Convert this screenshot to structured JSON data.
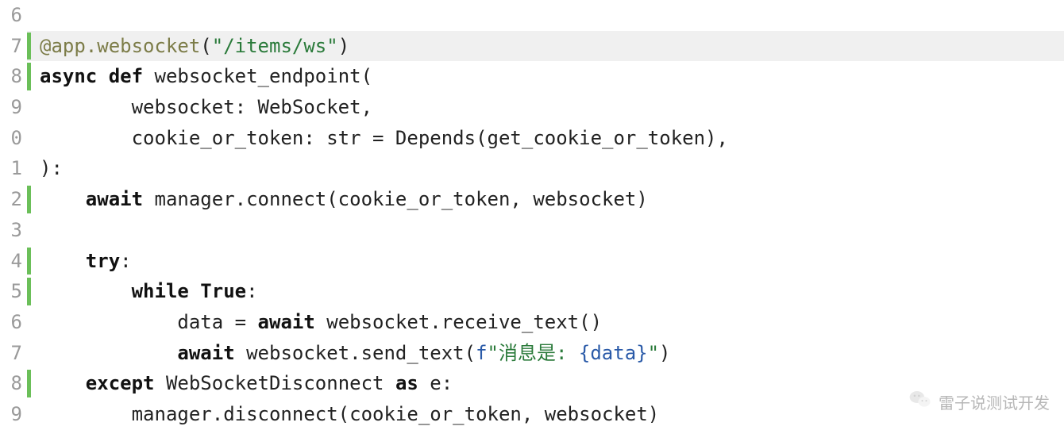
{
  "gutter": [
    "6",
    "7",
    "8",
    "9",
    "0",
    "1",
    "2",
    "3",
    "4",
    "5",
    "6",
    "7",
    "8",
    "9"
  ],
  "lines": [
    {
      "bar": false,
      "hl": false,
      "tokens": [
        {
          "t": "",
          "c": "plain"
        }
      ]
    },
    {
      "bar": true,
      "hl": true,
      "tokens": [
        {
          "t": "@app.websocket",
          "c": "decor"
        },
        {
          "t": "(",
          "c": "plain"
        },
        {
          "t": "\"/items/ws\"",
          "c": "str"
        },
        {
          "t": ")",
          "c": "plain"
        }
      ]
    },
    {
      "bar": true,
      "hl": false,
      "tokens": [
        {
          "t": "async def ",
          "c": "kw"
        },
        {
          "t": "websocket_endpoint",
          "c": "fn"
        },
        {
          "t": "(",
          "c": "plain"
        }
      ]
    },
    {
      "bar": false,
      "hl": false,
      "tokens": [
        {
          "t": "        websocket: WebSocket,",
          "c": "plain"
        }
      ]
    },
    {
      "bar": false,
      "hl": false,
      "tokens": [
        {
          "t": "        cookie_or_token: str = Depends(get_cookie_or_token),",
          "c": "plain"
        }
      ]
    },
    {
      "bar": false,
      "hl": false,
      "tokens": [
        {
          "t": "):",
          "c": "plain"
        }
      ]
    },
    {
      "bar": true,
      "hl": false,
      "tokens": [
        {
          "t": "    ",
          "c": "plain"
        },
        {
          "t": "await",
          "c": "kw"
        },
        {
          "t": " manager.connect(cookie_or_token, websocket)",
          "c": "plain"
        }
      ]
    },
    {
      "bar": false,
      "hl": false,
      "tokens": [
        {
          "t": "",
          "c": "plain"
        }
      ]
    },
    {
      "bar": true,
      "hl": false,
      "tokens": [
        {
          "t": "    ",
          "c": "plain"
        },
        {
          "t": "try",
          "c": "kw"
        },
        {
          "t": ":",
          "c": "plain"
        }
      ]
    },
    {
      "bar": true,
      "hl": false,
      "tokens": [
        {
          "t": "        ",
          "c": "plain"
        },
        {
          "t": "while ",
          "c": "kw"
        },
        {
          "t": "True",
          "c": "kw"
        },
        {
          "t": ":",
          "c": "plain"
        }
      ]
    },
    {
      "bar": false,
      "hl": false,
      "tokens": [
        {
          "t": "            data = ",
          "c": "plain"
        },
        {
          "t": "await",
          "c": "kw"
        },
        {
          "t": " websocket.receive_text()",
          "c": "plain"
        }
      ]
    },
    {
      "bar": false,
      "hl": false,
      "tokens": [
        {
          "t": "            ",
          "c": "plain"
        },
        {
          "t": "await",
          "c": "kw"
        },
        {
          "t": " websocket.send_text(",
          "c": "plain"
        },
        {
          "t": "f",
          "c": "fstr-pref"
        },
        {
          "t": "\"消息是: ",
          "c": "str"
        },
        {
          "t": "{",
          "c": "fstr-brace"
        },
        {
          "t": "data",
          "c": "fstr-inner"
        },
        {
          "t": "}",
          "c": "fstr-brace"
        },
        {
          "t": "\"",
          "c": "str"
        },
        {
          "t": ")",
          "c": "plain"
        }
      ]
    },
    {
      "bar": true,
      "hl": false,
      "tokens": [
        {
          "t": "    ",
          "c": "plain"
        },
        {
          "t": "except",
          "c": "kw"
        },
        {
          "t": " WebSocketDisconnect ",
          "c": "plain"
        },
        {
          "t": "as",
          "c": "kw"
        },
        {
          "t": " e:",
          "c": "plain"
        }
      ]
    },
    {
      "bar": false,
      "hl": false,
      "tokens": [
        {
          "t": "        manager.disconnect(cookie_or_token, websocket)",
          "c": "plain"
        }
      ]
    }
  ],
  "watermark": {
    "text": "雷子说测试开发"
  }
}
